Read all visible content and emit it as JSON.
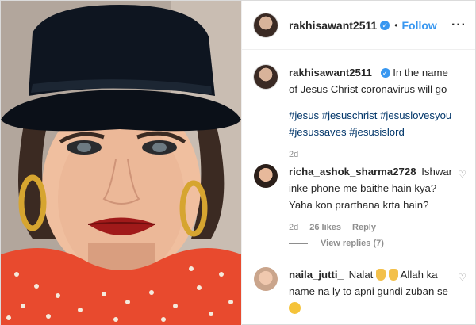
{
  "post": {
    "author": "rakhisawant2511",
    "follow_label": "Follow",
    "dot": "•",
    "more": "···",
    "caption": {
      "username": "rakhisawant2511",
      "text": "In the name of Jesus Christ coronavirus will go",
      "hashtags": "#jesus #jesuschrist #jesuslovesyou #jesussaves #jesusislord",
      "time": "2d"
    },
    "comments": [
      {
        "username": "richa_ashok_sharma2728",
        "text": "Ishwar inke phone me baithe hain kya? Yaha kon prarthana krta hain?",
        "time": "2d",
        "likes": "26 likes",
        "reply_label": "Reply",
        "view_replies": "View replies (7)"
      },
      {
        "username": "naila_jutti_",
        "text_a": "Nalat",
        "text_b": "Allah ka name na ly to apni gundi zuban se"
      }
    ]
  },
  "icons": [
    "verified-badge-icon",
    "more-options-icon",
    "heart-icon",
    "hand-emoji-icon",
    "sad-emoji-icon"
  ],
  "colors": {
    "accent": "#3897f0",
    "hashtag": "#003569",
    "muted": "#8e8e8e",
    "hat": "#0e1520",
    "sweater": "#e84a2e"
  }
}
